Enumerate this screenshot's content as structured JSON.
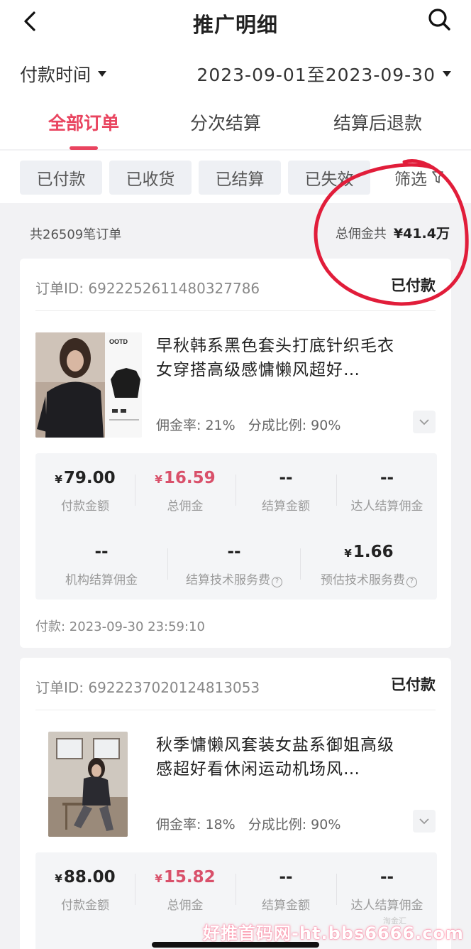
{
  "nav": {
    "title": "推广明细"
  },
  "filters": {
    "time_type": "付款时间",
    "date_range": "2023-09-01至2023-09-30"
  },
  "tabs": [
    {
      "label": "全部订单",
      "active": true
    },
    {
      "label": "分次结算",
      "active": false
    },
    {
      "label": "结算后退款",
      "active": false
    }
  ],
  "status_chips": [
    "已付款",
    "已收货",
    "已结算",
    "已失效"
  ],
  "screen_label": "筛选",
  "summary": {
    "count_text": "共26509笔订单",
    "total_label": "总佣金共",
    "total_value": "¥41.4万"
  },
  "orders": [
    {
      "id": "订单ID: 6922252611480327786",
      "status": "已付款",
      "title": "早秋韩系黑色套头打底针织毛衣女穿搭高级感慵懒风超好…",
      "thumb_text": "OOTD",
      "rate": "佣金率: 21%",
      "share": "分成比例: 90%",
      "metrics_row1": [
        {
          "value": "79.00",
          "yen": true,
          "label": "付款金额",
          "red": false
        },
        {
          "value": "16.59",
          "yen": true,
          "label": "总佣金",
          "red": true
        },
        {
          "value": "--",
          "yen": false,
          "label": "结算金额",
          "red": false
        },
        {
          "value": "--",
          "yen": false,
          "label": "达人结算佣金",
          "red": false
        }
      ],
      "metrics_row2": [
        {
          "value": "--",
          "yen": false,
          "label": "机构结算佣金",
          "help": false
        },
        {
          "value": "--",
          "yen": false,
          "label": "结算技术服务费",
          "help": true
        },
        {
          "value": "1.66",
          "yen": true,
          "label": "预估技术服务费",
          "help": true
        }
      ],
      "pay_time": "付款: 2023-09-30 23:59:10"
    },
    {
      "id": "订单ID: 6922237020124813053",
      "status": "已付款",
      "title": "秋季慵懒风套装女盐系御姐高级感超好看休闲运动机场风…",
      "rate": "佣金率: 18%",
      "share": "分成比例: 90%",
      "metrics_row1": [
        {
          "value": "88.00",
          "yen": true,
          "label": "付款金额",
          "red": false
        },
        {
          "value": "15.82",
          "yen": true,
          "label": "总佣金",
          "red": true
        },
        {
          "value": "--",
          "yen": false,
          "label": "结算金额",
          "red": false
        },
        {
          "value": "--",
          "yen": false,
          "label": "达人结算佣金",
          "red": false
        }
      ]
    }
  ],
  "yen_symbol": "¥",
  "watermark": "好推首码网-ht.bbs6666.com",
  "watermark_small": "淘金汇"
}
